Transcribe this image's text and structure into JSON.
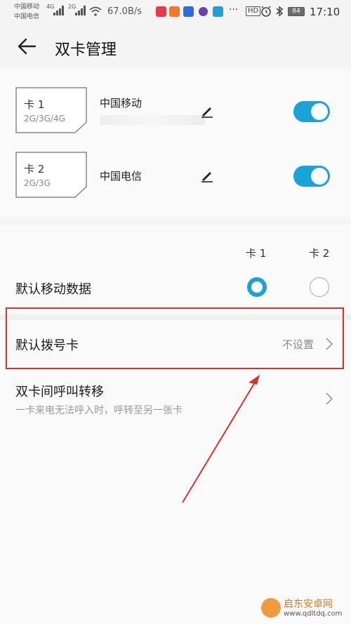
{
  "status_bar": {
    "carrier1": "中国移动",
    "carrier2": "中国电信",
    "net1": "4G",
    "net2": "2G",
    "speed": "67.0B/s",
    "more": "···",
    "hd": "HD",
    "battery": "84",
    "time": "17:10"
  },
  "header": {
    "title": "双卡管理"
  },
  "sims": [
    {
      "slot_label": "卡 1",
      "networks": "2G/3G/4G",
      "carrier": "中国移动",
      "enabled": true
    },
    {
      "slot_label": "卡 2",
      "networks": "2G/3G",
      "carrier": "中国电信",
      "enabled": true
    }
  ],
  "defaults": {
    "col1": "卡 1",
    "col2": "卡 2",
    "mobile_data_label": "默认移动数据",
    "mobile_data_selected": "卡 1",
    "dial_label": "默认拨号卡",
    "dial_value": "不设置",
    "forward_label": "双卡间呼叫转移",
    "forward_desc": "一卡来电无法呼入时，呼转至另一张卡"
  },
  "watermark": {
    "name": "启东安卓网",
    "url": "www.qdltdq.com"
  },
  "colors": {
    "accent": "#1aa3d6",
    "highlight": "#d9312b"
  }
}
